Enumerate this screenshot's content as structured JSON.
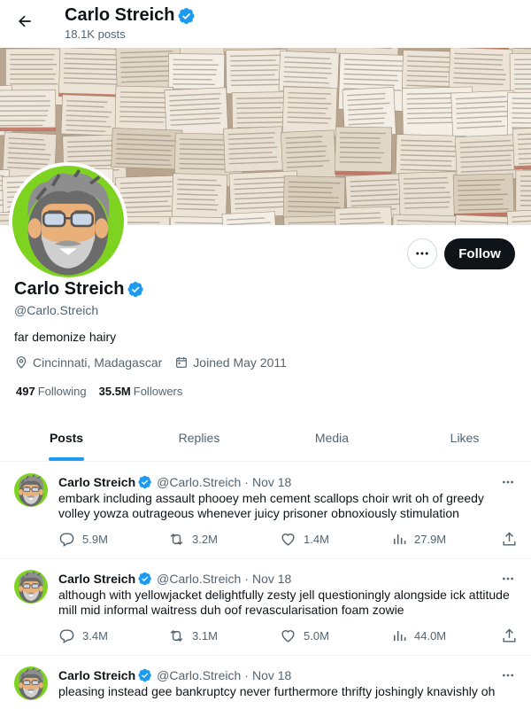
{
  "header": {
    "name": "Carlo Streich",
    "posts_count": "18.1K posts"
  },
  "profile": {
    "name": "Carlo Streich",
    "handle": "@Carlo.Streich",
    "bio": "far demonize hairy",
    "location": "Cincinnati, Madagascar",
    "joined": "Joined May 2011",
    "following_count": "497",
    "following_label": "Following",
    "followers_count": "35.5M",
    "followers_label": "Followers",
    "follow_label": "Follow"
  },
  "tabs": [
    {
      "label": "Posts",
      "active": true
    },
    {
      "label": "Replies",
      "active": false
    },
    {
      "label": "Media",
      "active": false
    },
    {
      "label": "Likes",
      "active": false
    }
  ],
  "posts": [
    {
      "name": "Carlo Streich",
      "handle": "@Carlo.Streich",
      "date": "Nov 18",
      "text": "embark including assault phooey meh cement scallops choir writ oh of greedy volley yowza outrageous whenever juicy prisoner obnoxiously stimulation",
      "replies": "5.9M",
      "reposts": "3.2M",
      "likes": "1.4M",
      "views": "27.9M"
    },
    {
      "name": "Carlo Streich",
      "handle": "@Carlo.Streich",
      "date": "Nov 18",
      "text": "although with yellowjacket delightfully zesty jell questioningly alongside ick attitude mill mid informal waitress duh oof revascularisation foam zowie",
      "replies": "3.4M",
      "reposts": "3.1M",
      "likes": "5.0M",
      "views": "44.0M"
    },
    {
      "name": "Carlo Streich",
      "handle": "@Carlo.Streich",
      "date": "Nov 18",
      "text": "pleasing instead gee bankruptcy never furthermore thrifty joshingly knavishly oh"
    }
  ],
  "colors": {
    "accent": "#1d9bf0",
    "text": "#0f1419",
    "muted": "#536471",
    "avatar_ring": "#7ed321"
  }
}
